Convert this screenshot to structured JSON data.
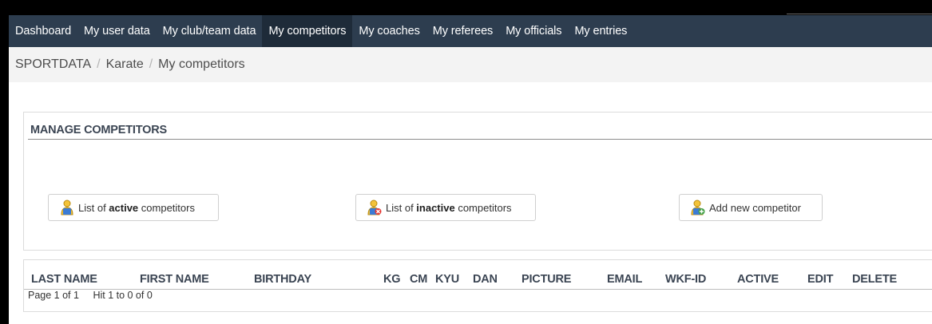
{
  "nav": {
    "items": [
      {
        "label": "Dashboard"
      },
      {
        "label": "My user data"
      },
      {
        "label": "My club/team data"
      },
      {
        "label": "My competitors"
      },
      {
        "label": "My coaches"
      },
      {
        "label": "My referees"
      },
      {
        "label": "My officials"
      },
      {
        "label": "My entries"
      }
    ],
    "active_index": 3
  },
  "breadcrumb": [
    "SPORTDATA",
    "Karate",
    "My competitors"
  ],
  "manage": {
    "title": "MANAGE COMPETITORS",
    "buttons": {
      "active": {
        "pre": "List of ",
        "bold": "active",
        "post": " competitors"
      },
      "inactive": {
        "pre": "List of ",
        "bold": "inactive",
        "post": " competitors"
      },
      "add": {
        "label": "Add new competitor"
      }
    }
  },
  "table": {
    "columns": [
      "LAST NAME",
      "FIRST NAME",
      "BIRTHDAY",
      "KG",
      "CM",
      "KYU",
      "DAN",
      "PICTURE",
      "EMAIL",
      "WKF-ID",
      "ACTIVE",
      "EDIT",
      "DELETE"
    ],
    "rows": [],
    "pager": {
      "page": "Page 1 of 1",
      "hits": "Hit 1 to 0 of 0"
    }
  },
  "colors": {
    "navbar": "#2d3d4f",
    "nav_active": "#1e2b39",
    "breadcrumb_bg": "#f3f3f3",
    "heading_text": "#3b4553"
  },
  "icons": {
    "active_button": "user-icon",
    "inactive_button": "user-remove-icon",
    "add_button": "user-add-icon"
  }
}
